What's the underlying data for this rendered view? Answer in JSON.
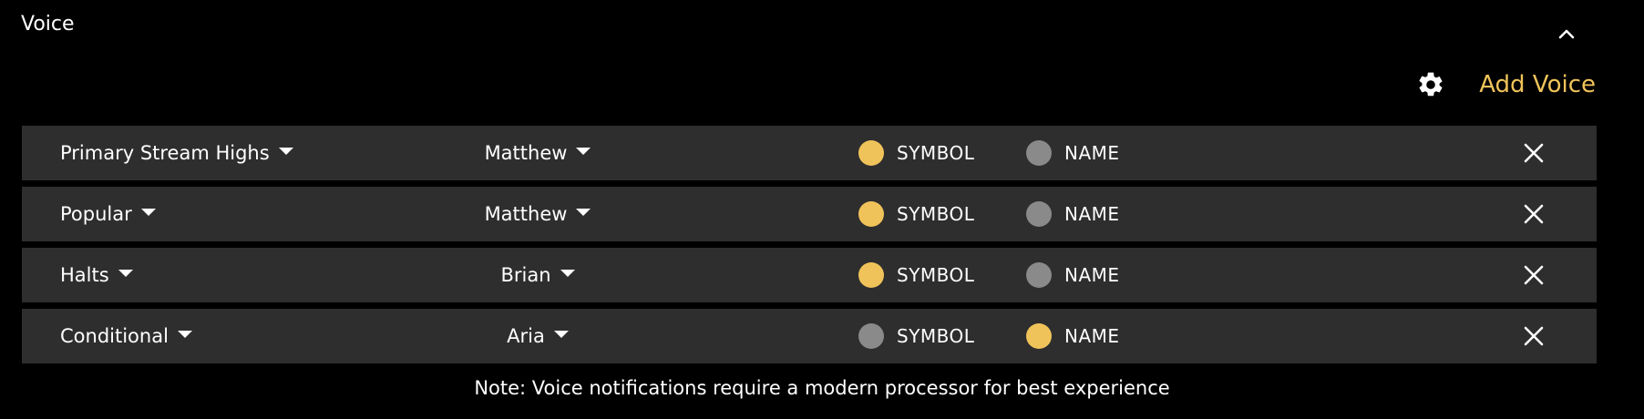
{
  "panel": {
    "title": "Voice"
  },
  "toolbar": {
    "add_voice_label": "Add Voice"
  },
  "colors": {
    "accent": "#f0c35a",
    "inactive": "#8a8a8a",
    "row_bg": "#2e2e2e"
  },
  "rows": [
    {
      "alert": "Primary Stream Highs",
      "voice": "Matthew",
      "symbol_label": "SYMBOL",
      "symbol_on": true,
      "name_label": "NAME",
      "name_on": false
    },
    {
      "alert": "Popular",
      "voice": "Matthew",
      "symbol_label": "SYMBOL",
      "symbol_on": true,
      "name_label": "NAME",
      "name_on": false
    },
    {
      "alert": "Halts",
      "voice": "Brian",
      "symbol_label": "SYMBOL",
      "symbol_on": true,
      "name_label": "NAME",
      "name_on": false
    },
    {
      "alert": "Conditional",
      "voice": "Aria",
      "symbol_label": "SYMBOL",
      "symbol_on": false,
      "name_label": "NAME",
      "name_on": true
    }
  ],
  "note": "Note: Voice notifications require a modern processor for best experience"
}
